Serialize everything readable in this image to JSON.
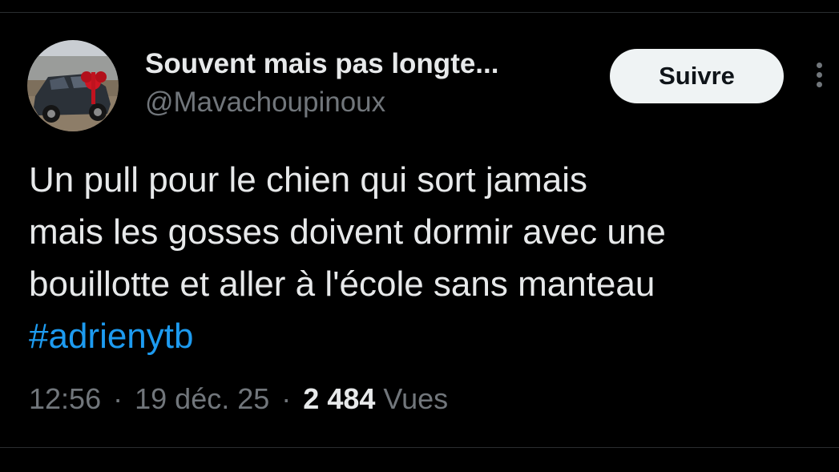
{
  "author": {
    "display_name": "Souvent mais pas longte...",
    "handle": "@Mavachoupinoux",
    "avatar_icon": "car-with-red-bow-avatar"
  },
  "follow_button": {
    "label": "Suivre"
  },
  "more_menu": {
    "icon": "vertical-ellipsis-icon"
  },
  "tweet": {
    "lines": [
      "Un pull pour le chien qui sort jamais",
      "mais les gosses doivent dormir avec une",
      "bouillotte et aller à l'école sans manteau"
    ],
    "hashtag": "#adrienytb"
  },
  "meta": {
    "time": "12:56",
    "separator": "·",
    "date": "19 déc. 25",
    "views_count": "2 484",
    "views_label": "Vues"
  },
  "colors": {
    "background": "#000000",
    "primary_text": "#e7e9ea",
    "secondary_text": "#71767b",
    "link": "#1d9bf0",
    "follow_button_bg": "#eff3f4",
    "follow_button_text": "#0f1419",
    "divider": "#2a2d30"
  }
}
